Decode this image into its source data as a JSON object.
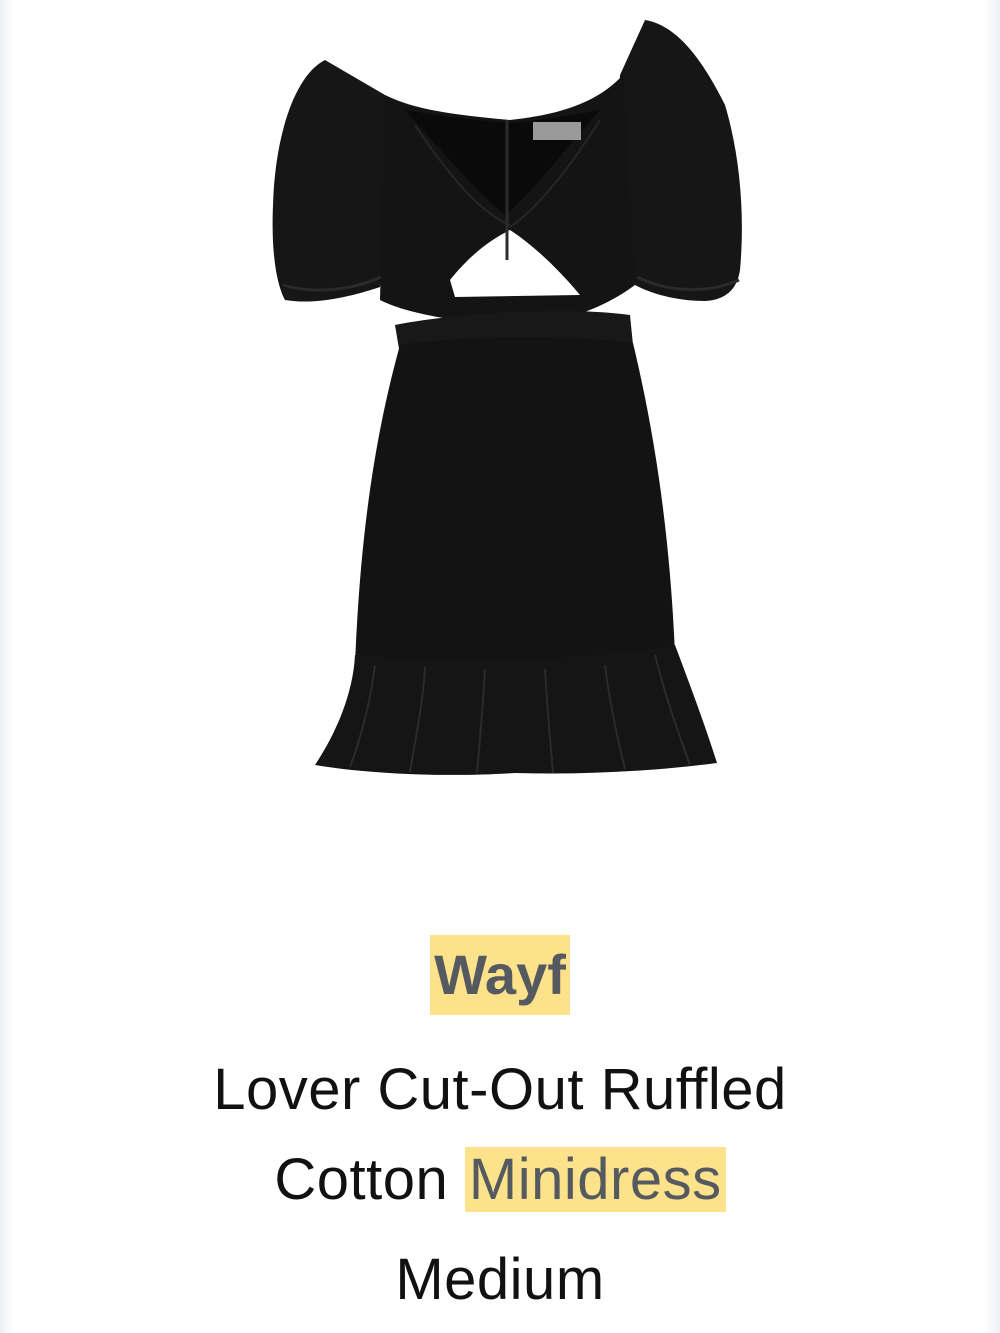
{
  "product": {
    "image_alt": "Black puff-sleeve cut-out ruffled minidress",
    "brand": "Wayf",
    "title_line1": "Lover Cut-Out Ruffled",
    "title_line2_plain": "Cotton ",
    "title_line2_highlight": "Minidress",
    "size": "Medium"
  },
  "colors": {
    "highlight": "#fde28c",
    "dress": "#121212",
    "highlighted_text": "#555a60"
  }
}
